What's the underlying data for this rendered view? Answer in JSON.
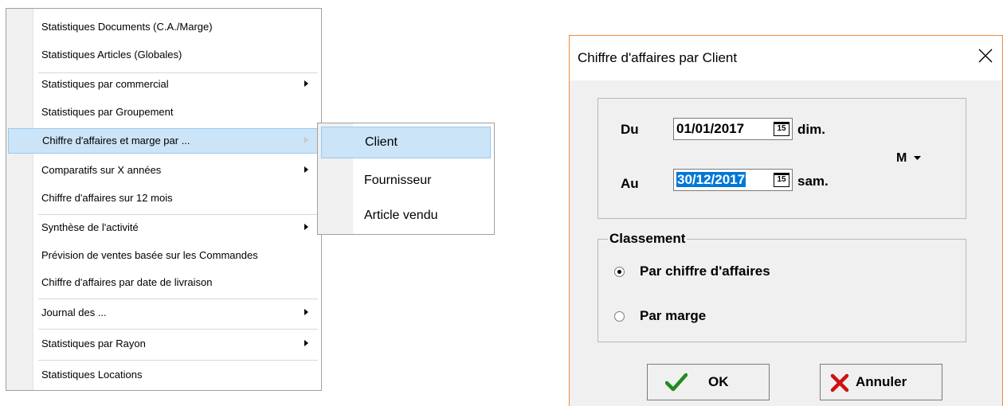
{
  "context_menu": {
    "items": [
      {
        "label": "Statistiques Documents  (C.A./Marge)",
        "submenu": false
      },
      {
        "label": "Statistiques Articles (Globales)",
        "submenu": false
      },
      {
        "label": "Statistiques par commercial",
        "submenu": true
      },
      {
        "label": "Statistiques par Groupement",
        "submenu": false
      },
      {
        "label": "Chiffre d'affaires et marge par ...",
        "submenu": true,
        "highlighted": true
      },
      {
        "label": "Comparatifs sur X années",
        "submenu": true
      },
      {
        "label": "Chiffre d'affaires sur 12 mois",
        "submenu": false
      },
      {
        "label": "Synthèse de l'activité",
        "submenu": true
      },
      {
        "label": "Prévision de ventes basée sur les Commandes",
        "submenu": false
      },
      {
        "label": "Chiffre d'affaires par date de livraison",
        "submenu": false
      },
      {
        "label": "Journal des ...",
        "submenu": true
      },
      {
        "label": "Statistiques par Rayon",
        "submenu": true
      },
      {
        "label": "Statistiques Locations",
        "submenu": false
      }
    ]
  },
  "submenu": {
    "items": [
      {
        "label": "Client",
        "highlighted": true
      },
      {
        "label": "Fournisseur"
      },
      {
        "label": "Article vendu"
      }
    ]
  },
  "dialog": {
    "title": "Chiffre d'affaires par Client",
    "date_group": {
      "from_label": "Du",
      "from_value": "01/01/2017",
      "from_day": "dim.",
      "to_label": "Au",
      "to_value": "30/12/2017",
      "to_day": "sam.",
      "calendar_icon_text": "15",
      "period_menu_label": "M"
    },
    "classement": {
      "title": "Classement",
      "options": [
        {
          "label": "Par chiffre d'affaires",
          "selected": true
        },
        {
          "label": "Par marge",
          "selected": false
        }
      ]
    },
    "buttons": {
      "ok_label": "OK",
      "cancel_label": "Annuler"
    },
    "colors": {
      "ok_check": "#1e8c1e",
      "cancel_x": "#d01010",
      "selection": "#0078d7",
      "dialog_border": "#ef8a3d"
    }
  }
}
